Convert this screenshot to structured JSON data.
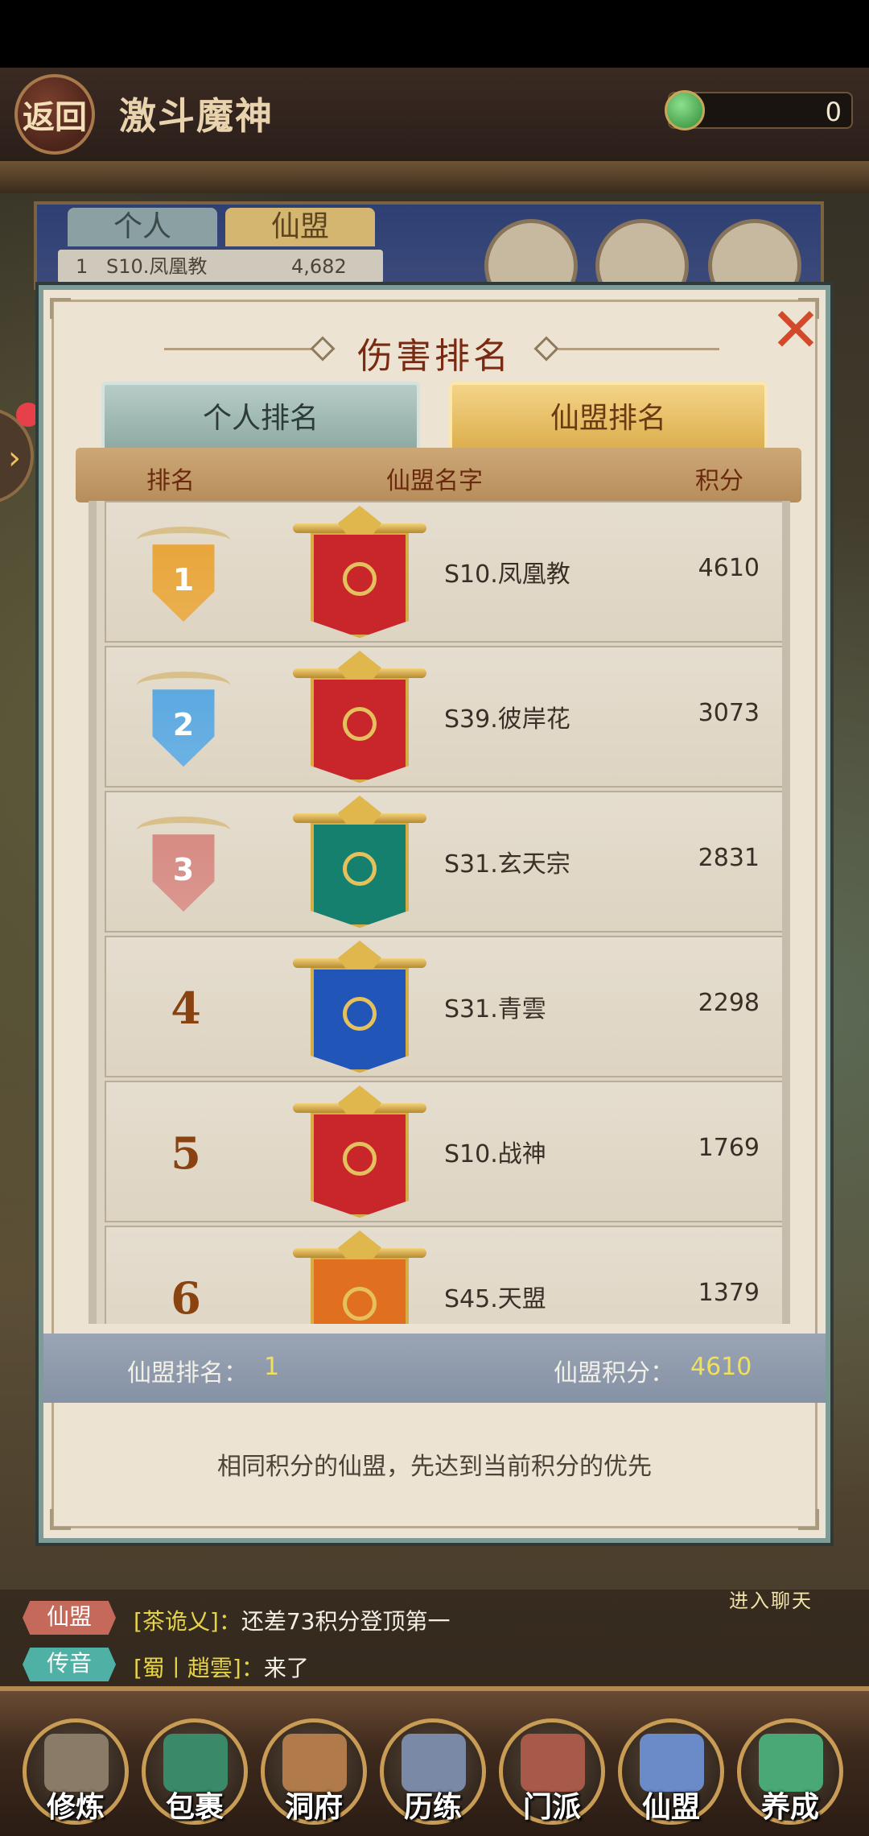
{
  "header": {
    "back_label": "返回",
    "title": "激斗魔神",
    "currency_value": "0"
  },
  "background_panel": {
    "tabs": [
      "个人",
      "仙盟"
    ],
    "top_row": {
      "rank": "1",
      "name": "S10.凤凰教",
      "score": "4,682"
    }
  },
  "dialog": {
    "title": "伤害排名",
    "close_icon": "close-icon",
    "tabs": {
      "personal": "个人排名",
      "alliance": "仙盟排名",
      "active": "alliance"
    },
    "columns": {
      "rank": "排名",
      "name": "仙盟名字",
      "score": "积分"
    },
    "rows": [
      {
        "rank": "1",
        "name": "S10.凤凰教",
        "score": "4610",
        "medal_color": "#e8a53a",
        "banner_color": "#c8262b",
        "emblem": "phoenix"
      },
      {
        "rank": "2",
        "name": "S39.彼岸花",
        "score": "3073",
        "medal_color": "#5aa8e0",
        "banner_color": "#c8262b",
        "emblem": "phoenix"
      },
      {
        "rank": "3",
        "name": "S31.玄天宗",
        "score": "2831",
        "medal_color": "#d68a82",
        "banner_color": "#15806e",
        "emblem": "swirl"
      },
      {
        "rank": "4",
        "name": "S31.青雲",
        "score": "2298",
        "medal_color": null,
        "banner_color": "#2156b8",
        "emblem": "moon"
      },
      {
        "rank": "5",
        "name": "S10.战神",
        "score": "1769",
        "medal_color": null,
        "banner_color": "#c8262b",
        "emblem": "phoenix"
      },
      {
        "rank": "6",
        "name": "S45.天盟",
        "score": "1379",
        "medal_color": null,
        "banner_color": "#e0701f",
        "emblem": "sun"
      }
    ],
    "footer": {
      "my_rank_label": "仙盟排名：",
      "my_rank_value": "1",
      "my_score_label": "仙盟积分：",
      "my_score_value": "4610"
    },
    "note": "相同积分的仙盟，先达到当前积分的优先"
  },
  "chat": {
    "enter_label": "进入聊天",
    "messages": [
      {
        "channel": "仙盟",
        "sender": "[茶诡乂]：",
        "text": "还差73积分登顶第一"
      },
      {
        "channel": "传音",
        "sender": "[蜀丨趙雲]：",
        "text": "来了"
      }
    ]
  },
  "bottom_nav": [
    {
      "label": "修炼",
      "color": "#8a7a68"
    },
    {
      "label": "包裹",
      "color": "#3a8a6a"
    },
    {
      "label": "洞府",
      "color": "#b07a4a"
    },
    {
      "label": "历练",
      "color": "#7a8aa6"
    },
    {
      "label": "门派",
      "color": "#a85a4a"
    },
    {
      "label": "仙盟",
      "color": "#6a8ac8"
    },
    {
      "label": "养成",
      "color": "#4aa876"
    }
  ]
}
